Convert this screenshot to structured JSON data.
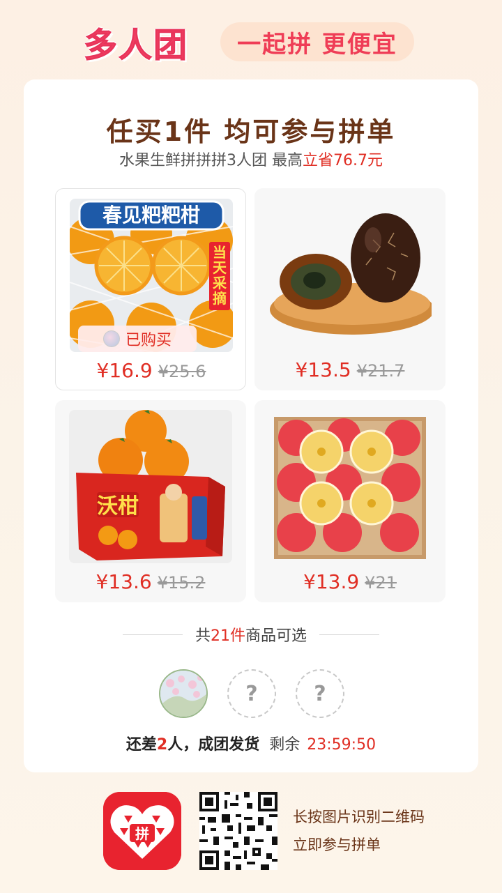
{
  "header": {
    "logo": "多人团",
    "slogan": "一起拼 更便宜"
  },
  "card": {
    "title": "任买1件 均可参与拼单",
    "subtitle_prefix": "水果生鲜拼拼拼3人团 最高",
    "subtitle_highlight": "立省76.7元"
  },
  "products": [
    {
      "image_text": "春见粑粑柑",
      "side_badge": "当天采摘",
      "tag": "已购买",
      "price": "¥16.9",
      "original_price": "¥25.6",
      "selected": true
    },
    {
      "price": "¥13.5",
      "original_price": "¥21.7"
    },
    {
      "image_text": "沃柑",
      "price": "¥13.6",
      "original_price": "¥15.2"
    },
    {
      "price": "¥13.9",
      "original_price": "¥21"
    }
  ],
  "selection": {
    "prefix": "共",
    "count": "21件",
    "suffix": "商品可选"
  },
  "group": {
    "empty_slot_symbol": "?",
    "status_prefix": "还差",
    "missing_count": "2",
    "status_suffix": "人，成团发货",
    "remaining_label": "剩余",
    "countdown": "23:59:50"
  },
  "footer": {
    "app_icon_text": "拼",
    "line1": "长按图片识别二维码",
    "line2": "立即参与拼单"
  },
  "colors": {
    "accent_red": "#e02e24",
    "brand_pink": "#f03f63",
    "title_brown": "#6a3418"
  }
}
